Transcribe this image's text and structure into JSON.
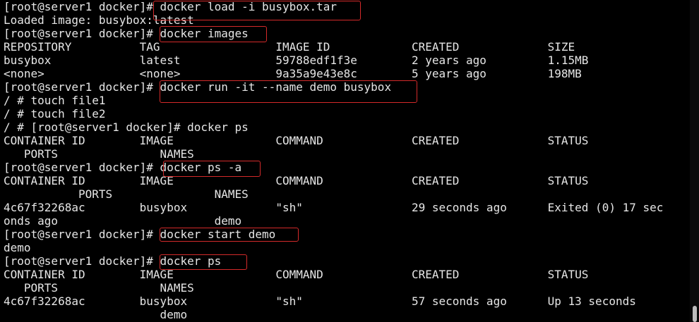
{
  "terminal": {
    "lines": [
      "[root@server1 docker]# docker load -i busybox.tar",
      "Loaded image: busybox:latest",
      "[root@server1 docker]# docker images",
      "REPOSITORY          TAG                 IMAGE ID            CREATED             SIZE",
      "busybox             latest              59788edf1f3e        2 years ago         1.15MB",
      "<none>              <none>              9a35a9e43e8c        5 years ago         198MB",
      "[root@server1 docker]# docker run -it --name demo busybox",
      "/ # touch file1",
      "/ # touch file2",
      "/ # [root@server1 docker]# docker ps",
      "CONTAINER ID        IMAGE               COMMAND             CREATED             STATUS",
      "   PORTS               NAMES",
      "[root@server1 docker]# docker ps -a",
      "CONTAINER ID        IMAGE               COMMAND             CREATED             STATUS",
      "           PORTS               NAMES",
      "4c67f32268ac        busybox             \"sh\"                29 seconds ago      Exited (0) 17 sec",
      "onds ago                       demo",
      "[root@server1 docker]# docker start demo",
      "demo",
      "[root@server1 docker]# docker ps",
      "CONTAINER ID        IMAGE               COMMAND             CREATED             STATUS",
      "   PORTS               NAMES",
      "4c67f32268ac        busybox             \"sh\"                57 seconds ago      Up 13 seconds",
      "                       demo"
    ]
  },
  "colors": {
    "background": "#000000",
    "text": "#e6e6e6",
    "highlight_box": "#d42a2a",
    "scrollbar_thumb": "#bdbdbd"
  }
}
